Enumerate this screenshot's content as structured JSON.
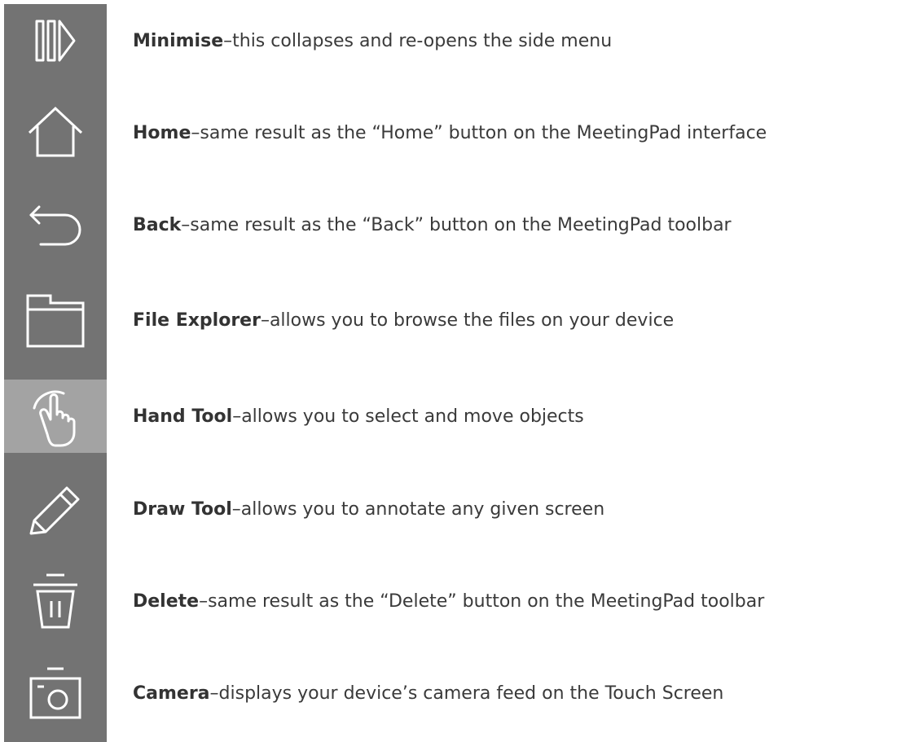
{
  "colors": {
    "sidebar": "#737373",
    "sidebar_active": "#a3a3a3",
    "icon_stroke": "#ffffff",
    "text": "#3a3a3a"
  },
  "items": [
    {
      "name": "Minimise",
      "sep": " – ",
      "text": "this collapses and re-opens the side menu",
      "icon": "minimise-icon",
      "active": false
    },
    {
      "name": "Home",
      "sep": " – ",
      "text": "same result as the “Home” button on the MeetingPad interface",
      "icon": "home-icon",
      "active": false
    },
    {
      "name": "Back",
      "sep": " – ",
      "text": "same result as the “Back” button on the MeetingPad toolbar",
      "icon": "back-icon",
      "active": false
    },
    {
      "name": "File Explorer",
      "sep": " – ",
      "text": "allows you to browse the files on your device",
      "icon": "folder-icon",
      "active": false
    },
    {
      "name": "Hand Tool",
      "sep": " – ",
      "text": "allows you to select and move objects",
      "icon": "hand-icon",
      "active": true
    },
    {
      "name": "Draw Tool",
      "sep": " – ",
      "text": "allows you to annotate any given screen",
      "icon": "pencil-icon",
      "active": false
    },
    {
      "name": "Delete",
      "sep": " – ",
      "text": "same result as the “Delete” button on the MeetingPad toolbar",
      "icon": "trash-icon",
      "active": false
    },
    {
      "name": "Camera",
      "sep": " – ",
      "text": "displays your device’s camera feed on the Touch Screen",
      "icon": "camera-icon",
      "active": false
    }
  ]
}
